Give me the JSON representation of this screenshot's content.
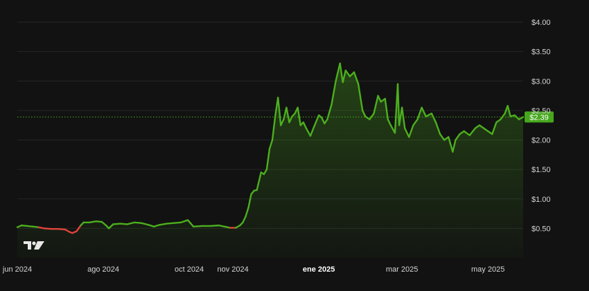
{
  "chart_data": {
    "type": "area",
    "title": "",
    "xlabel": "",
    "ylabel": "",
    "ylim": [
      0.0,
      4.2
    ],
    "y_ticks": [
      {
        "value": 0.5,
        "label": "$0.50"
      },
      {
        "value": 1.0,
        "label": "$1.00"
      },
      {
        "value": 1.5,
        "label": "$1.50"
      },
      {
        "value": 2.0,
        "label": "$2.00"
      },
      {
        "value": 2.5,
        "label": "$2.50"
      },
      {
        "value": 3.0,
        "label": "$3.00"
      },
      {
        "value": 3.5,
        "label": "$3.50"
      },
      {
        "value": 4.0,
        "label": "$4.00"
      }
    ],
    "x_ticks": [
      {
        "date": "2024-06-01",
        "label": "jun 2024",
        "bold": false
      },
      {
        "date": "2024-08-01",
        "label": "ago 2024",
        "bold": false
      },
      {
        "date": "2024-10-01",
        "label": "oct 2024",
        "bold": false
      },
      {
        "date": "2024-11-01",
        "label": "nov 2024",
        "bold": false
      },
      {
        "date": "2025-01-01",
        "label": "ene 2025",
        "bold": true
      },
      {
        "date": "2025-03-01",
        "label": "mar 2025",
        "bold": false
      },
      {
        "date": "2025-05-01",
        "label": "may 2025",
        "bold": false
      }
    ],
    "x_range": [
      "2024-06-01",
      "2025-05-26"
    ],
    "current_price": {
      "value": 2.39,
      "label": "$2.39"
    },
    "reference_price": 0.52,
    "grid": true,
    "colors": {
      "up": "#4caf1e",
      "down": "#e0443c",
      "price_tag": "#46a71c",
      "grid": "#262626",
      "background": "#121212"
    },
    "series": [
      {
        "points": [
          [
            "2024-06-01",
            0.52
          ],
          [
            "2024-06-04",
            0.55
          ],
          [
            "2024-06-08",
            0.54
          ],
          [
            "2024-06-12",
            0.53
          ],
          [
            "2024-06-16",
            0.52
          ],
          [
            "2024-06-20",
            0.5
          ],
          [
            "2024-06-25",
            0.49
          ],
          [
            "2024-06-30",
            0.49
          ],
          [
            "2024-07-05",
            0.48
          ],
          [
            "2024-07-08",
            0.44
          ],
          [
            "2024-07-10",
            0.42
          ],
          [
            "2024-07-13",
            0.45
          ],
          [
            "2024-07-16",
            0.55
          ],
          [
            "2024-07-18",
            0.6
          ],
          [
            "2024-07-22",
            0.6
          ],
          [
            "2024-07-27",
            0.62
          ],
          [
            "2024-07-31",
            0.61
          ],
          [
            "2024-08-03",
            0.55
          ],
          [
            "2024-08-05",
            0.5
          ],
          [
            "2024-08-08",
            0.57
          ],
          [
            "2024-08-13",
            0.58
          ],
          [
            "2024-08-18",
            0.57
          ],
          [
            "2024-08-23",
            0.6
          ],
          [
            "2024-08-28",
            0.59
          ],
          [
            "2024-09-02",
            0.56
          ],
          [
            "2024-09-06",
            0.53
          ],
          [
            "2024-09-10",
            0.56
          ],
          [
            "2024-09-15",
            0.58
          ],
          [
            "2024-09-20",
            0.59
          ],
          [
            "2024-09-25",
            0.6
          ],
          [
            "2024-09-30",
            0.64
          ],
          [
            "2024-10-04",
            0.53
          ],
          [
            "2024-10-10",
            0.54
          ],
          [
            "2024-10-16",
            0.54
          ],
          [
            "2024-10-22",
            0.55
          ],
          [
            "2024-10-26",
            0.53
          ],
          [
            "2024-10-30",
            0.51
          ],
          [
            "2024-11-03",
            0.51
          ],
          [
            "2024-11-06",
            0.55
          ],
          [
            "2024-11-08",
            0.6
          ],
          [
            "2024-11-10",
            0.7
          ],
          [
            "2024-11-12",
            0.85
          ],
          [
            "2024-11-14",
            1.08
          ],
          [
            "2024-11-16",
            1.14
          ],
          [
            "2024-11-18",
            1.15
          ],
          [
            "2024-11-21",
            1.45
          ],
          [
            "2024-11-23",
            1.42
          ],
          [
            "2024-11-25",
            1.5
          ],
          [
            "2024-11-27",
            1.85
          ],
          [
            "2024-11-29",
            2.0
          ],
          [
            "2024-12-01",
            2.4
          ],
          [
            "2024-12-03",
            2.72
          ],
          [
            "2024-12-05",
            2.25
          ],
          [
            "2024-12-07",
            2.35
          ],
          [
            "2024-12-09",
            2.55
          ],
          [
            "2024-12-11",
            2.3
          ],
          [
            "2024-12-13",
            2.4
          ],
          [
            "2024-12-15",
            2.45
          ],
          [
            "2024-12-17",
            2.55
          ],
          [
            "2024-12-19",
            2.25
          ],
          [
            "2024-12-21",
            2.3
          ],
          [
            "2024-12-23",
            2.2
          ],
          [
            "2024-12-26",
            2.07
          ],
          [
            "2024-12-29",
            2.25
          ],
          [
            "2025-01-01",
            2.42
          ],
          [
            "2025-01-03",
            2.38
          ],
          [
            "2025-01-05",
            2.28
          ],
          [
            "2025-01-07",
            2.35
          ],
          [
            "2025-01-10",
            2.6
          ],
          [
            "2025-01-13",
            3.0
          ],
          [
            "2025-01-16",
            3.3
          ],
          [
            "2025-01-18",
            2.98
          ],
          [
            "2025-01-20",
            3.18
          ],
          [
            "2025-01-23",
            3.08
          ],
          [
            "2025-01-26",
            3.15
          ],
          [
            "2025-01-29",
            2.95
          ],
          [
            "2025-02-01",
            2.5
          ],
          [
            "2025-02-03",
            2.4
          ],
          [
            "2025-02-06",
            2.35
          ],
          [
            "2025-02-09",
            2.45
          ],
          [
            "2025-02-12",
            2.75
          ],
          [
            "2025-02-14",
            2.65
          ],
          [
            "2025-02-17",
            2.7
          ],
          [
            "2025-02-19",
            2.35
          ],
          [
            "2025-02-21",
            2.25
          ],
          [
            "2025-02-24",
            2.12
          ],
          [
            "2025-02-26",
            2.95
          ],
          [
            "2025-02-27",
            2.25
          ],
          [
            "2025-03-01",
            2.55
          ],
          [
            "2025-03-03",
            2.2
          ],
          [
            "2025-03-06",
            2.05
          ],
          [
            "2025-03-09",
            2.25
          ],
          [
            "2025-03-12",
            2.35
          ],
          [
            "2025-03-15",
            2.55
          ],
          [
            "2025-03-18",
            2.4
          ],
          [
            "2025-03-22",
            2.45
          ],
          [
            "2025-03-25",
            2.3
          ],
          [
            "2025-03-28",
            2.1
          ],
          [
            "2025-03-31",
            2.0
          ],
          [
            "2025-04-03",
            2.05
          ],
          [
            "2025-04-06",
            1.8
          ],
          [
            "2025-04-08",
            2.0
          ],
          [
            "2025-04-11",
            2.1
          ],
          [
            "2025-04-14",
            2.15
          ],
          [
            "2025-04-18",
            2.08
          ],
          [
            "2025-04-22",
            2.2
          ],
          [
            "2025-04-25",
            2.25
          ],
          [
            "2025-04-28",
            2.2
          ],
          [
            "2025-05-01",
            2.15
          ],
          [
            "2025-05-04",
            2.1
          ],
          [
            "2025-05-07",
            2.3
          ],
          [
            "2025-05-10",
            2.35
          ],
          [
            "2025-05-13",
            2.45
          ],
          [
            "2025-05-15",
            2.58
          ],
          [
            "2025-05-17",
            2.4
          ],
          [
            "2025-05-20",
            2.42
          ],
          [
            "2025-05-23",
            2.35
          ],
          [
            "2025-05-26",
            2.39
          ]
        ]
      }
    ]
  }
}
